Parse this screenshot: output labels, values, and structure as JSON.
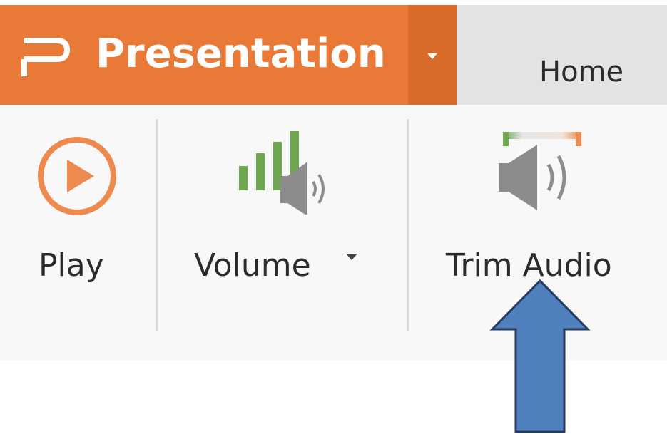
{
  "titlebar": {
    "app_title": "Presentation",
    "logo_icon": "presentation-logo-icon",
    "dropdown_icon": "triangle-down-icon"
  },
  "tabs": {
    "home_label": "Home"
  },
  "ribbon": {
    "play": {
      "label": "Play",
      "icon": "play-circle-icon"
    },
    "volume": {
      "label": "Volume",
      "icon": "volume-bars-speaker-icon",
      "caret_icon": "triangle-down-icon"
    },
    "trim_audio": {
      "label": "Trim Audio",
      "icon": "trim-audio-speaker-icon"
    }
  },
  "annotation": {
    "arrow_icon": "up-arrow-icon"
  },
  "colors": {
    "brand": "#e87936",
    "brand_dark": "#d86a2a",
    "tab_strip": "#e3e3e3",
    "ribbon_bg": "#f8f8f8",
    "play_accent": "#ee8a4d",
    "volume_bars": "#6ea84e",
    "speaker": "#8c8c8c",
    "arrow_fill": "#4f7fbd",
    "arrow_stroke": "#243a5e"
  }
}
